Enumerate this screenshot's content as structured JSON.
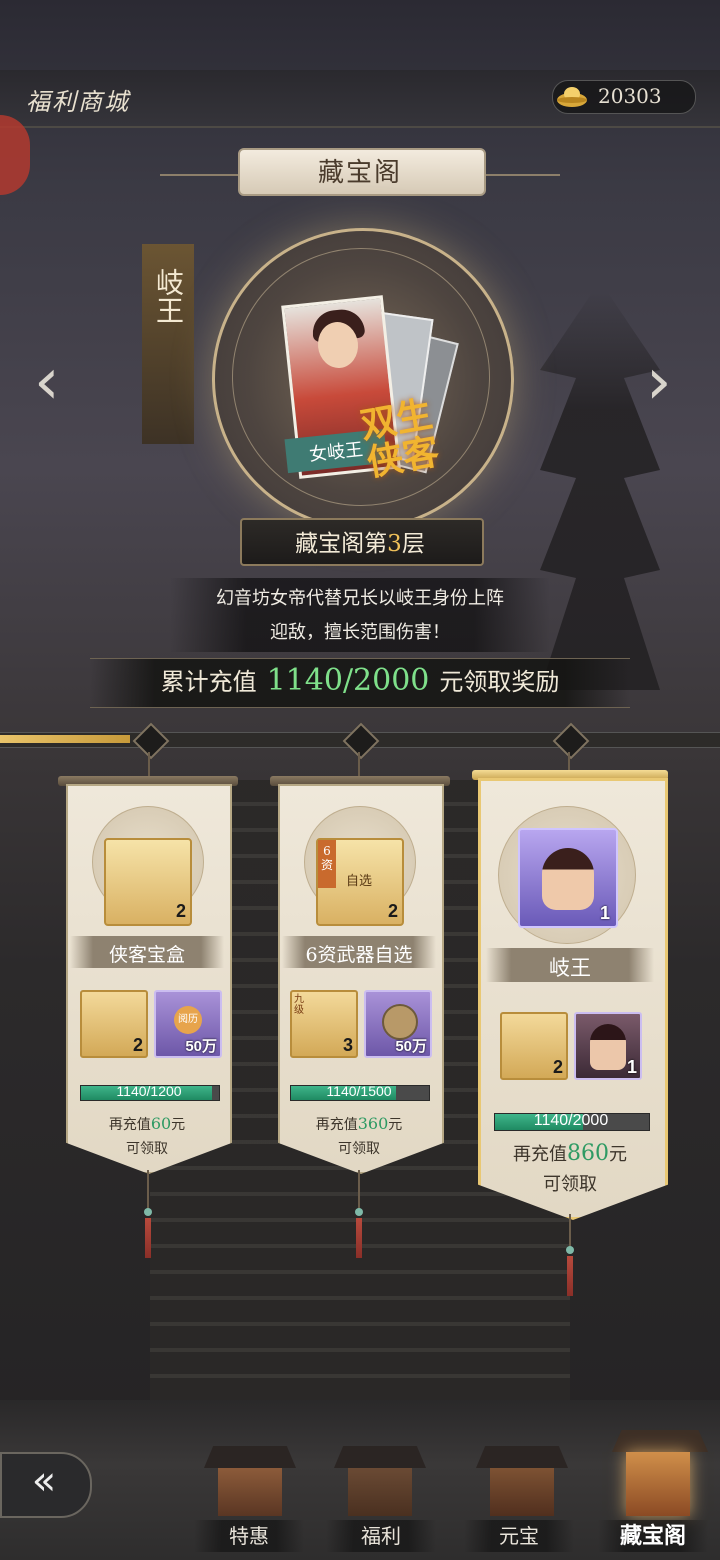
{
  "header": {
    "title": "福利商城",
    "currency_value": "20303"
  },
  "page": {
    "title": "藏宝阁"
  },
  "hero": {
    "side_name": "岐王",
    "card_name": "女岐王",
    "card_art_text": "双生侠客",
    "floor_prefix": "藏宝阁第",
    "floor_number": "3",
    "floor_suffix": "层",
    "description_line1": "幻音坊女帝代替兄长以岐王身份上阵",
    "description_line2": "迎敌，擅长范围伤害！",
    "prev_icon": "chevron-left-icon",
    "next_icon": "chevron-right-icon"
  },
  "recharge": {
    "prefix": "累计充值",
    "value": "1140/2000",
    "suffix": "元领取奖励",
    "current": 1140,
    "target": 2000,
    "track_progress": 0.18
  },
  "tiers": [
    {
      "main_item": {
        "name": "侠客宝盒",
        "count": "2",
        "icon": "treasure-chest-icon"
      },
      "sub_items": [
        {
          "count": "2",
          "icon": "gold-ingot-icon"
        },
        {
          "count": "50万",
          "icon": "experience-token-icon",
          "icon_text": "阅历"
        }
      ],
      "progress_text": "1140/1200",
      "progress": 0.95,
      "need_prefix": "再充值",
      "need_amount": "60",
      "need_suffix": "元",
      "claim_text": "可领取"
    },
    {
      "main_item": {
        "name": "6资武器自选",
        "count": "2",
        "icon": "weapon-chest-icon",
        "badge": "6资",
        "icon_text": "自选"
      },
      "sub_items": [
        {
          "count": "3",
          "icon": "gem-bag-icon",
          "icon_text": "九级"
        },
        {
          "count": "50万",
          "icon": "copper-coin-icon"
        }
      ],
      "progress_text": "1140/1500",
      "progress": 0.76,
      "need_prefix": "再充值",
      "need_amount": "360",
      "need_suffix": "元",
      "claim_text": "可领取"
    },
    {
      "main_item": {
        "name": "岐王",
        "count": "1",
        "icon": "hero-portrait-icon"
      },
      "sub_items": [
        {
          "count": "2",
          "icon": "gold-ingot-icon"
        },
        {
          "count": "1",
          "icon": "hero-avatar-icon"
        }
      ],
      "progress_text": "1140/2000",
      "progress": 0.57,
      "need_prefix": "再充值",
      "need_amount": "860",
      "need_suffix": "元",
      "claim_text": "可领取"
    }
  ],
  "nav": {
    "back_icon": "back-arrow-icon",
    "tabs": [
      {
        "label": "特惠"
      },
      {
        "label": "福利"
      },
      {
        "label": "元宝"
      },
      {
        "label": "藏宝阁",
        "active": true
      }
    ]
  },
  "colors": {
    "accent_green": "#7fe08a",
    "gold": "#e9c46a",
    "progress_green": "#2e9a63"
  }
}
